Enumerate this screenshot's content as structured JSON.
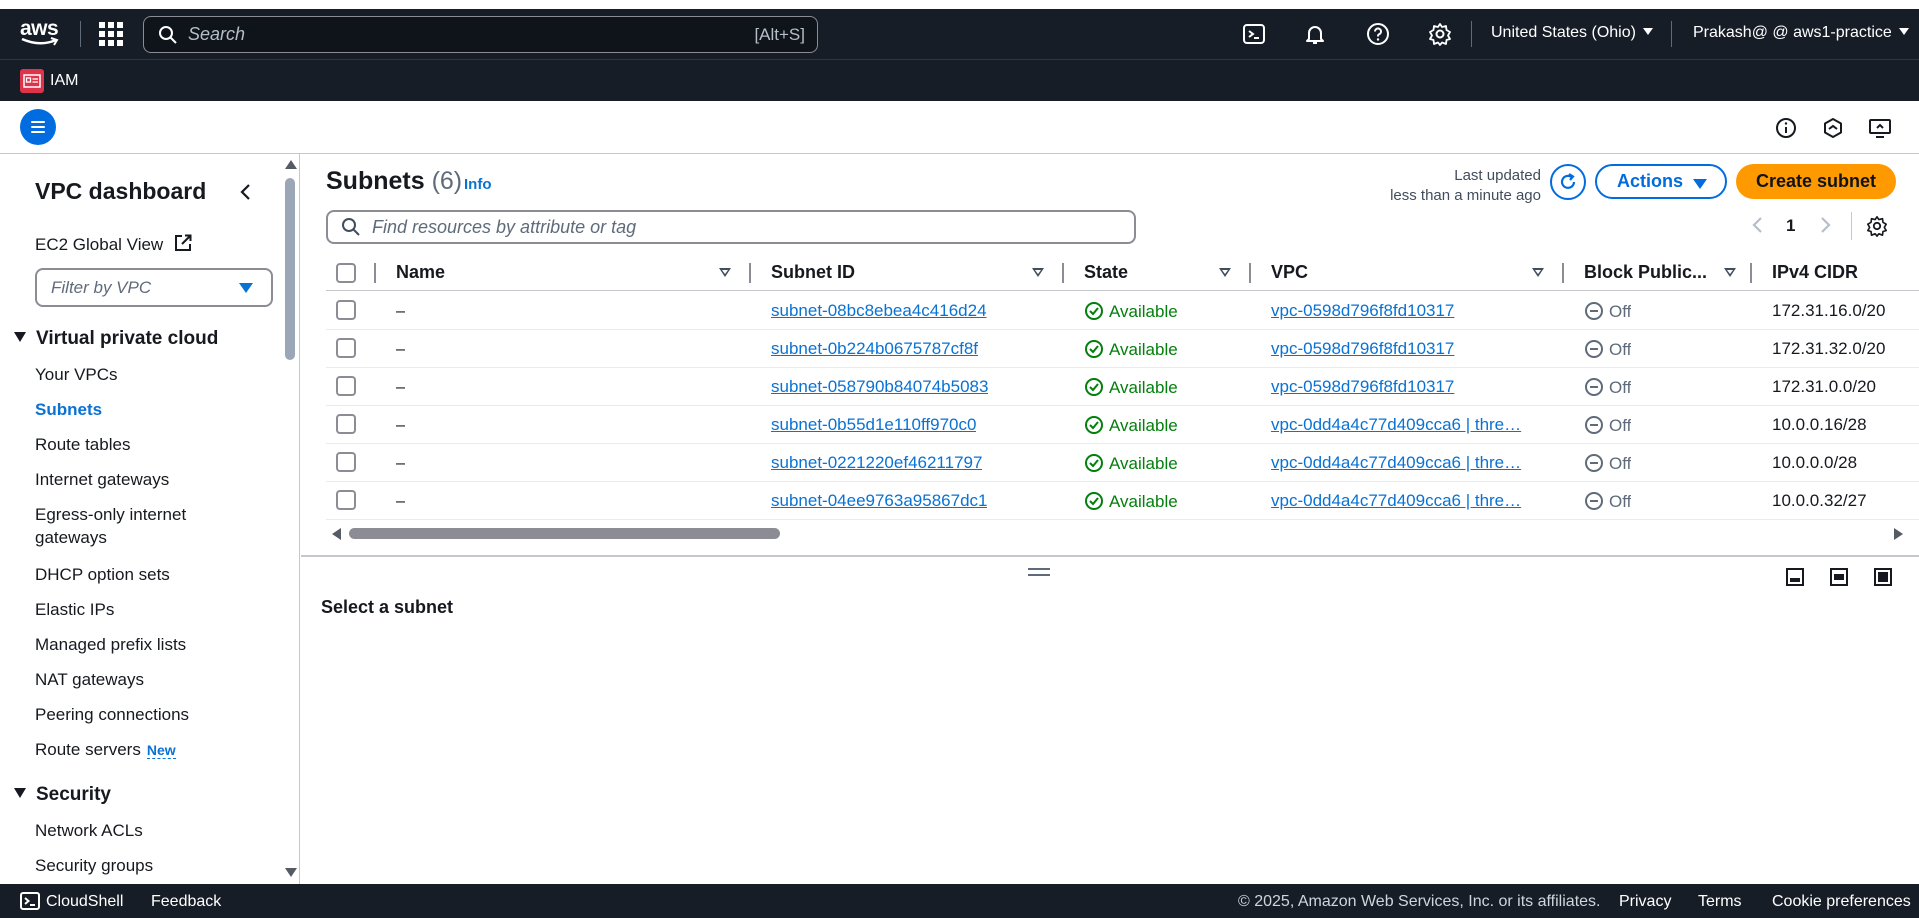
{
  "topnav": {
    "logo_text": "aws",
    "search_placeholder": "Search",
    "search_shortcut": "[Alt+S]",
    "region": "United States (Ohio)",
    "account": "Prakash@ @ aws1-practice",
    "icons": [
      "services-grid-icon",
      "cloudshell-icon",
      "bell-icon",
      "help-icon",
      "settings-icon"
    ]
  },
  "servicebar": {
    "service": "IAM"
  },
  "sidebar": {
    "title": "VPC dashboard",
    "global_view": "EC2 Global View",
    "filter_placeholder": "Filter by VPC",
    "sections": [
      {
        "heading": "Virtual private cloud",
        "items": [
          "Your VPCs",
          "Subnets",
          "Route tables",
          "Internet gateways",
          "Egress-only internet",
          "gateways",
          "DHCP option sets",
          "Elastic IPs",
          "Managed prefix lists",
          "NAT gateways",
          "Peering connections",
          "Route servers"
        ],
        "new_badge": "New",
        "active": "Subnets"
      },
      {
        "heading": "Security",
        "items": [
          "Network ACLs",
          "Security groups"
        ]
      }
    ]
  },
  "main": {
    "title": "Subnets",
    "count": "(6)",
    "info": "Info",
    "last_updated_label": "Last updated",
    "last_updated_value": "less than a minute ago",
    "actions_label": "Actions",
    "create_label": "Create subnet",
    "find_placeholder": "Find resources by attribute or tag",
    "page": "1",
    "columns": [
      "Name",
      "Subnet ID",
      "State",
      "VPC",
      "Block Public...",
      "IPv4 CIDR"
    ],
    "rows": [
      {
        "name": "–",
        "subnet_id": "subnet-08bc8ebea4c416d24",
        "state": "Available",
        "vpc": "vpc-0598d796f8fd10317",
        "block": "Off",
        "cidr": "172.31.16.0/20"
      },
      {
        "name": "–",
        "subnet_id": "subnet-0b224b0675787cf8f",
        "state": "Available",
        "vpc": "vpc-0598d796f8fd10317",
        "block": "Off",
        "cidr": "172.31.32.0/20"
      },
      {
        "name": "–",
        "subnet_id": "subnet-058790b84074b5083",
        "state": "Available",
        "vpc": "vpc-0598d796f8fd10317",
        "block": "Off",
        "cidr": "172.31.0.0/20"
      },
      {
        "name": "–",
        "subnet_id": "subnet-0b55d1e110ff970c0",
        "state": "Available",
        "vpc": "vpc-0dd4a4c77d409cca6 | thre…",
        "block": "Off",
        "cidr": "10.0.0.16/28"
      },
      {
        "name": "–",
        "subnet_id": "subnet-0221220ef46211797",
        "state": "Available",
        "vpc": "vpc-0dd4a4c77d409cca6 | thre…",
        "block": "Off",
        "cidr": "10.0.0.0/28"
      },
      {
        "name": "–",
        "subnet_id": "subnet-04ee9763a95867dc1",
        "state": "Available",
        "vpc": "vpc-0dd4a4c77d409cca6 | thre…",
        "block": "Off",
        "cidr": "10.0.0.32/27"
      }
    ],
    "detail_placeholder": "Select a subnet"
  },
  "footer": {
    "cloudshell": "CloudShell",
    "feedback": "Feedback",
    "copyright": "© 2025, Amazon Web Services, Inc. or its affiliates.",
    "privacy": "Privacy",
    "terms": "Terms",
    "cookies": "Cookie preferences"
  },
  "colors": {
    "nav_bg": "#161d26",
    "link": "#0972d3",
    "primary_button": "#ff9900",
    "available": "#037f0c",
    "iam_badge": "#dd344c"
  }
}
